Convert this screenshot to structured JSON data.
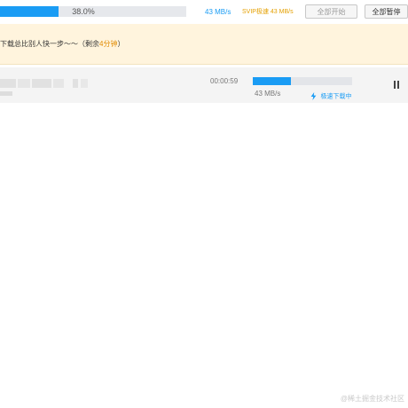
{
  "toolbar": {
    "total_progress_percent": 38.0,
    "total_progress_label": "38.0%",
    "speed": "43 MB/s",
    "svip_speed": "SVIP极速 43 MB/s",
    "start_all_label": "全部开始",
    "pause_all_label": "全部暂停",
    "colors": {
      "accent": "#1a9cf4",
      "svip": "#e5a000"
    }
  },
  "notice": {
    "message": "下载总比别人快一步～～",
    "remaining_prefix": "（剩余",
    "remaining_time": "4分钟",
    "remaining_suffix": "）",
    "colors": {
      "background": "#fff4dd",
      "highlight": "#e08a00"
    }
  },
  "task": {
    "elapsed_time": "00:00:59",
    "progress_percent": 38,
    "speed": "43 MB/s",
    "status_label": "极速下载中",
    "status_icon": "lightning-icon",
    "action_icon": "pause-icon"
  },
  "watermark": "@稀土掘金技术社区"
}
